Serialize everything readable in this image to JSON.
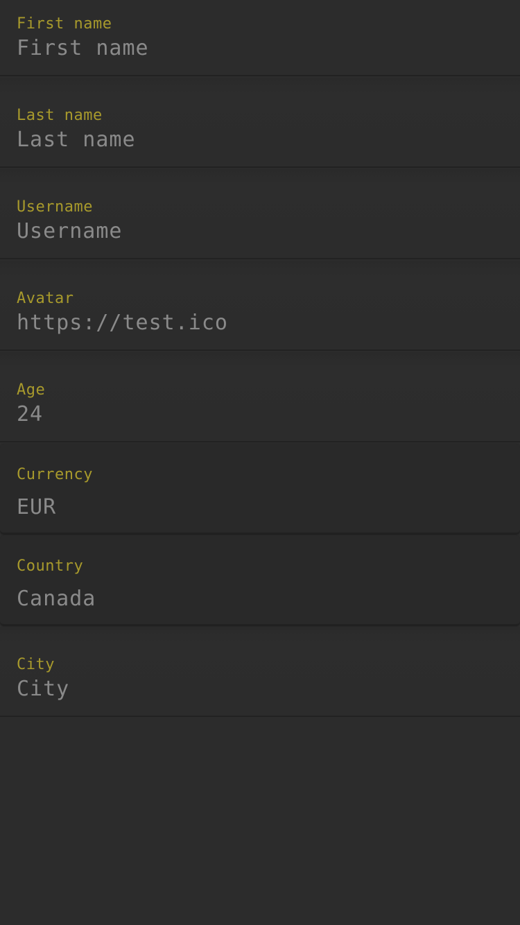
{
  "fields": [
    {
      "label": "First name",
      "value": "First name"
    },
    {
      "label": "Last name",
      "value": "Last name"
    },
    {
      "label": "Username",
      "value": "Username"
    },
    {
      "label": "Avatar",
      "value": "https://test.ico"
    },
    {
      "label": "Age",
      "value": "24"
    },
    {
      "label": "Currency",
      "value": "EUR"
    },
    {
      "label": "Country",
      "value": "Canada"
    },
    {
      "label": "City",
      "value": "City"
    }
  ],
  "colors": {
    "background": "#2c2c2c",
    "label": "#a89a2c",
    "value": "#8a8a8a"
  }
}
